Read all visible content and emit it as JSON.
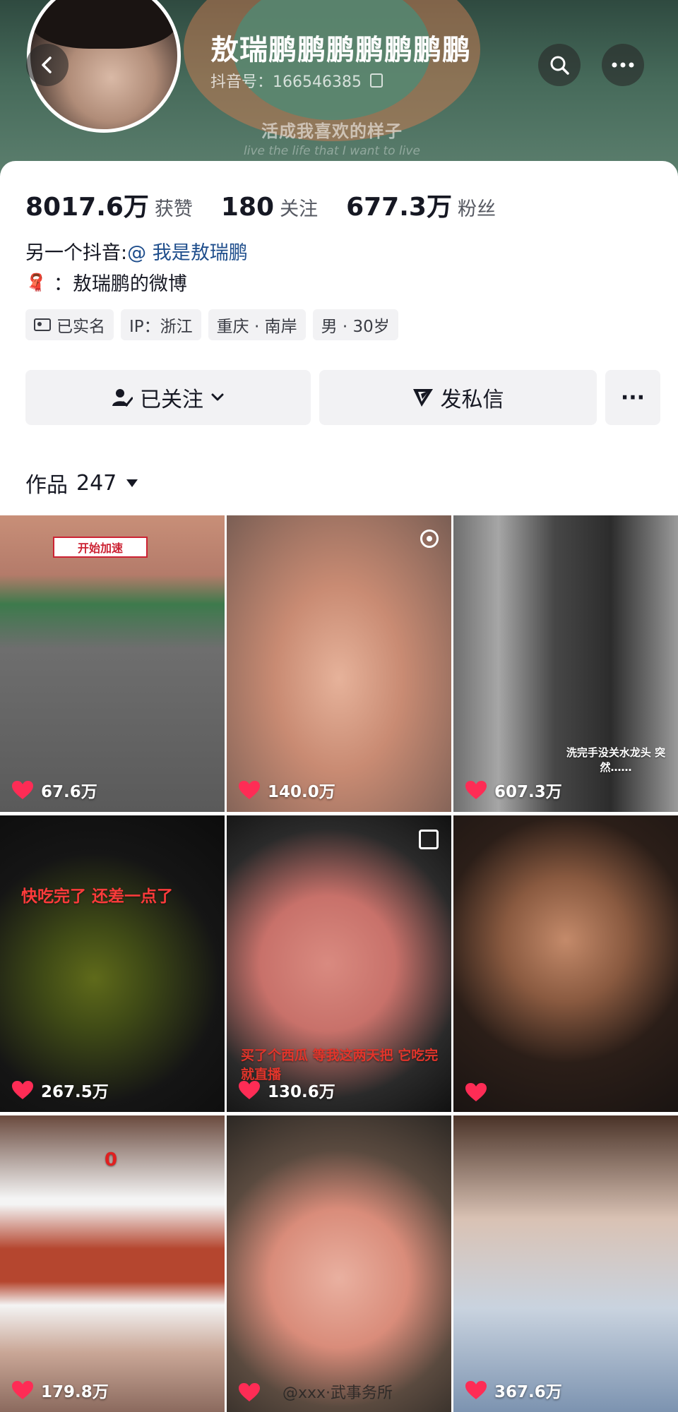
{
  "profile": {
    "username": "敖瑞鹏鹏鹏鹏鹏鹏鹏",
    "douyin_id": "抖音号：166546385",
    "cover_caption": "活成我喜欢的样子",
    "cover_caption_en": "live the life that I want to live",
    "stats": [
      {
        "value": "8017.6万",
        "label": "获赞"
      },
      {
        "value": "180",
        "label": "关注"
      },
      {
        "value": "677.3万",
        "label": "粉丝"
      }
    ],
    "bio_line1_prefix": "另一个抖音:",
    "bio_line1_mention": "@ 我是敖瑞鹏",
    "bio_line2": "：敖瑞鹏的微博",
    "tags": [
      "已实名",
      "IP：浙江",
      "重庆 · 南岸",
      "男 · 30岁"
    ]
  },
  "actions": {
    "followed": "已关注",
    "message": "发私信",
    "more": "···"
  },
  "works": {
    "label": "作品",
    "count": "247"
  },
  "videos": [
    {
      "likes": "67.6万",
      "text": "开始加速"
    },
    {
      "likes": "140.0万",
      "text": ""
    },
    {
      "likes": "607.3万",
      "text": "洗完手没关水龙头 突然……"
    },
    {
      "likes": "267.5万",
      "text": "快吃完了 还差一点了"
    },
    {
      "likes": "130.6万",
      "text": "买了个西瓜 等我这两天把 它吃完就直播"
    },
    {
      "likes": "",
      "text": ""
    },
    {
      "likes": "179.8万",
      "text": "0"
    },
    {
      "likes": "",
      "text": ""
    },
    {
      "likes": "367.6万",
      "text": ""
    }
  ],
  "watermark": "@xxx·武事务所",
  "colors": {
    "accent_heart": "#fe2c55",
    "mention": "#1f4e8c",
    "button_bg": "#f2f2f4"
  }
}
